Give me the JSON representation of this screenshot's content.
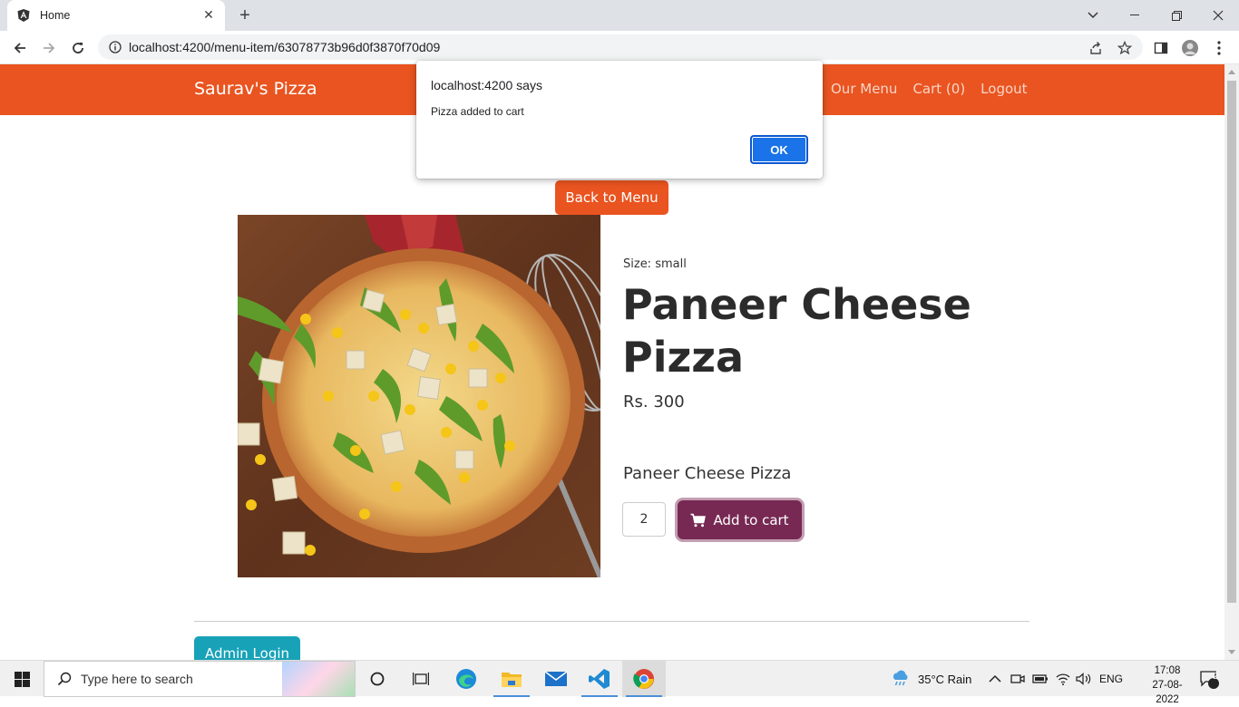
{
  "browser": {
    "tab_title": "Home",
    "url": "localhost:4200/menu-item/63078773b96d0f3870f70d09"
  },
  "navbar": {
    "brand": "Saurav's Pizza",
    "links": [
      "Our Menu",
      "Cart (0)",
      "Logout"
    ]
  },
  "page": {
    "back_label": "Back to Menu",
    "size_text": "Size: small",
    "title": "Paneer Cheese Pizza",
    "price": "Rs. 300",
    "description": "Paneer Cheese Pizza",
    "quantity": "2",
    "add_to_cart_label": "Add to cart",
    "admin_login_label": "Admin Login"
  },
  "dialog": {
    "title": "localhost:4200 says",
    "message": "Pizza added to cart",
    "ok_label": "OK"
  },
  "taskbar": {
    "search_placeholder": "Type here to search",
    "weather": "35°C  Rain",
    "language": "ENG",
    "time": "17:08",
    "date": "27-08-2022",
    "notification_count": "2"
  },
  "colors": {
    "navbar": "#e95420",
    "add_to_cart": "#772953",
    "admin_login": "#17a2b8",
    "dialog_ok": "#1a73e8"
  }
}
